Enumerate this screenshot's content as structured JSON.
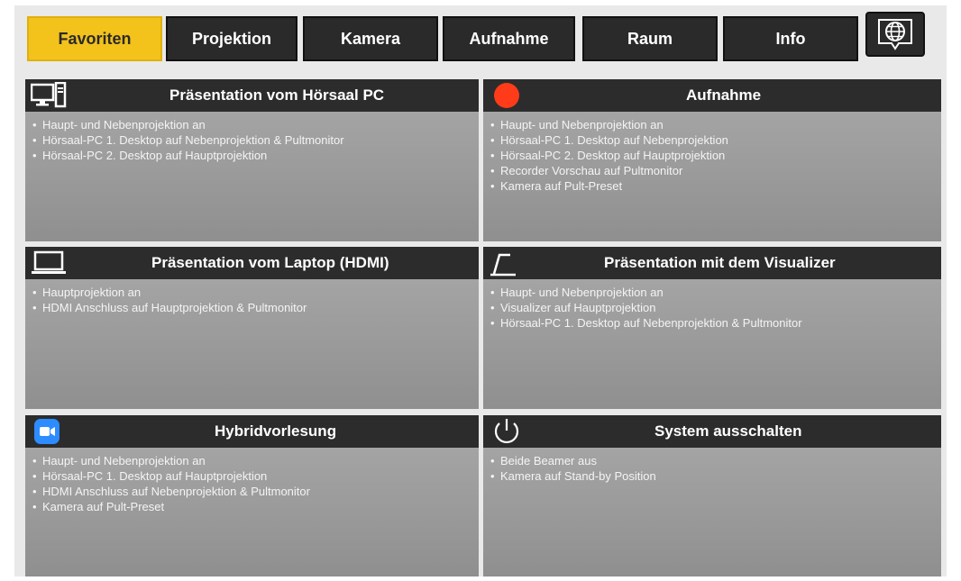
{
  "tabs": [
    {
      "label": "Favoriten",
      "active": true
    },
    {
      "label": "Projektion",
      "active": false
    },
    {
      "label": "Kamera",
      "active": false
    },
    {
      "label": "Aufnahme",
      "active": false
    },
    {
      "label": "Raum",
      "active": false
    },
    {
      "label": "Info",
      "active": false
    }
  ],
  "language_icon": "globe-speech-bubble-icon",
  "tiles": [
    {
      "title": "Präsentation vom Hörsaal PC",
      "icon": "desktop-pc-icon",
      "items": [
        "Haupt- und Nebenprojektion an",
        "Hörsaal-PC 1. Desktop auf Nebenprojektion & Pultmonitor",
        "Hörsaal-PC 2. Desktop auf Hauptprojektion"
      ]
    },
    {
      "title": "Aufnahme",
      "icon": "record-dot-icon",
      "items": [
        "Haupt- und Nebenprojektion an",
        "Hörsaal-PC 1. Desktop auf Nebenprojektion",
        "Hörsaal-PC 2. Desktop auf Hauptprojektion",
        "Recorder Vorschau auf Pultmonitor",
        "Kamera auf Pult-Preset"
      ]
    },
    {
      "title": "Präsentation vom Laptop (HDMI)",
      "icon": "laptop-icon",
      "items": [
        "Hauptprojektion an",
        "HDMI Anschluss auf Hauptprojektion & Pultmonitor"
      ]
    },
    {
      "title": "Präsentation mit dem Visualizer",
      "icon": "visualizer-icon",
      "items": [
        "Haupt- und Nebenprojektion an",
        "Visualizer auf Hauptprojektion",
        "Hörsaal-PC 1. Desktop auf Nebenprojektion & Pultmonitor"
      ]
    },
    {
      "title": "Hybridvorlesung",
      "icon": "zoom-camera-icon",
      "items": [
        "Haupt- und Nebenprojektion an",
        "Hörsaal-PC 1. Desktop auf Hauptprojektion",
        "HDMI Anschluss auf Nebenprojektion & Pultmonitor",
        "Kamera auf Pult-Preset"
      ]
    },
    {
      "title": "System ausschalten",
      "icon": "power-icon",
      "items": [
        "Beide Beamer aus",
        "Kamera auf Stand-by Position"
      ]
    }
  ],
  "colors": {
    "active_tab": "#f3c21b",
    "tab_background": "#2a2a2a",
    "record_dot": "#ff3b1a",
    "zoom_blue": "#2d8cff"
  }
}
